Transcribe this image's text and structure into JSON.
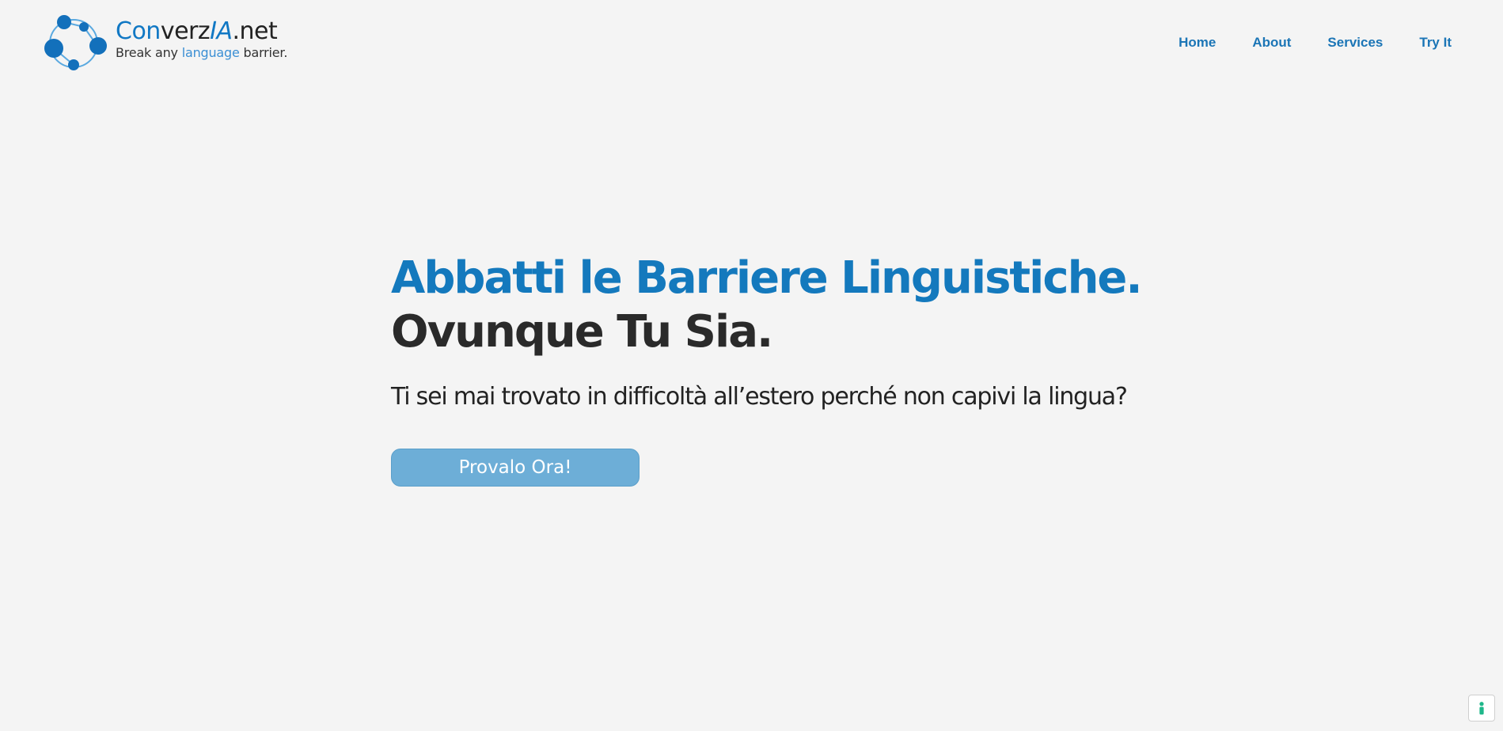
{
  "header": {
    "logo": {
      "brand_part1": "Con",
      "brand_part2": "verz",
      "brand_part3": "IA",
      "brand_part4": ".net",
      "tagline_part1": "Break any ",
      "tagline_highlight": "language",
      "tagline_part2": " barrier."
    },
    "nav": [
      {
        "label": "Home"
      },
      {
        "label": "About"
      },
      {
        "label": "Services"
      },
      {
        "label": "Try It"
      }
    ]
  },
  "hero": {
    "title_line1": "Abbatti le Barriere Linguistiche.",
    "title_line2": "Ovunque Tu Sia.",
    "subtitle": "Ti sei mai trovato in difficoltà all’estero perché non capivi la lingua?",
    "cta_label": "Provalo Ora!"
  },
  "colors": {
    "accent": "#1479bd",
    "nav_link": "#1b75b6",
    "cta_background": "#6daed7",
    "page_background": "#f4f4f4",
    "accessibility_icon": "#1fb78a"
  },
  "icons": {
    "logo_mark": "network-circles-icon",
    "floating_button": "accessibility-icon"
  }
}
